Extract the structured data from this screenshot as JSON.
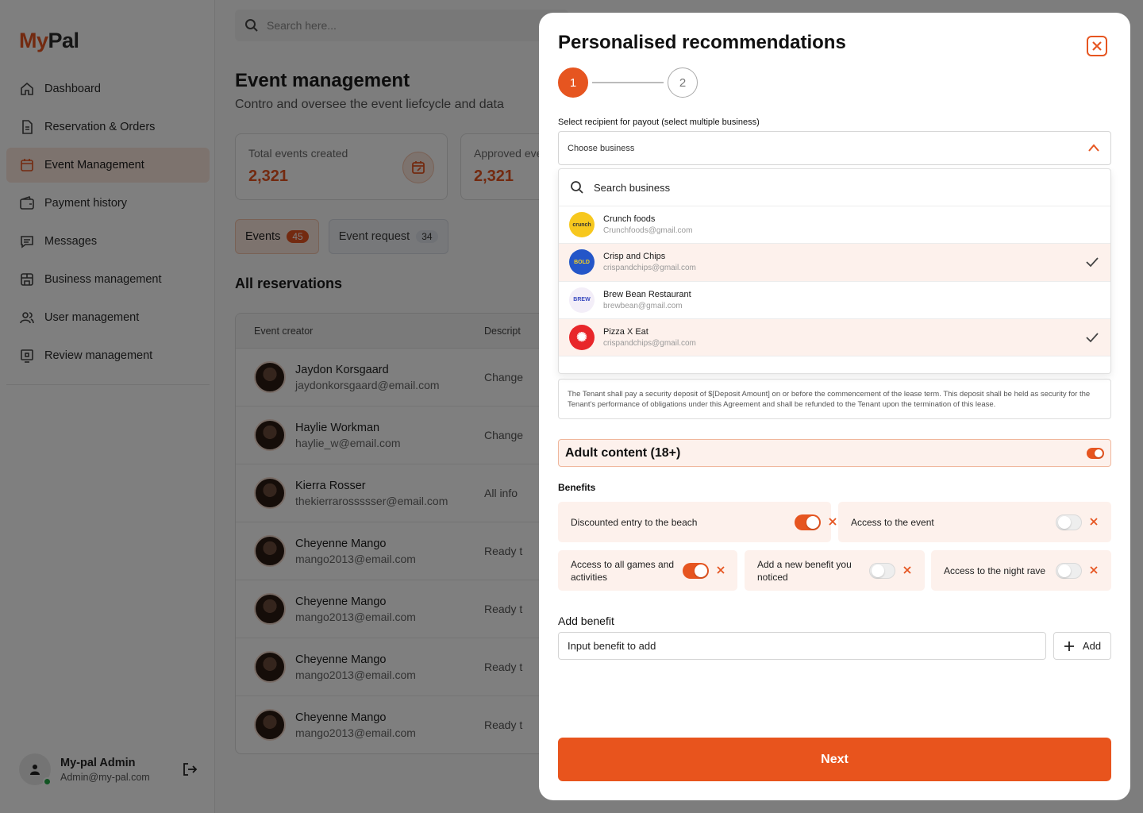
{
  "app": {
    "logo_a": "My",
    "logo_b": "Pal"
  },
  "sidebar": {
    "items": [
      {
        "label": "Dashboard",
        "icon": "home-icon"
      },
      {
        "label": "Reservation & Orders",
        "icon": "document-icon"
      },
      {
        "label": "Event Management",
        "icon": "calendar-icon",
        "active": true
      },
      {
        "label": "Payment history",
        "icon": "wallet-icon"
      },
      {
        "label": "Messages",
        "icon": "message-icon"
      },
      {
        "label": "Business management",
        "icon": "store-icon"
      },
      {
        "label": "User management",
        "icon": "users-icon"
      },
      {
        "label": "Review management",
        "icon": "review-icon"
      }
    ],
    "profile": {
      "name": "My-pal Admin",
      "email": "Admin@my-pal.com"
    }
  },
  "main": {
    "search_placeholder": "Search here...",
    "title": "Event management",
    "subtitle": "Contro and oversee the event liefcycle and data",
    "stats": [
      {
        "label": "Total events created",
        "value": "2,321"
      },
      {
        "label": "Approved eve",
        "value": "2,321"
      }
    ],
    "tabs": [
      {
        "label": "Events",
        "count": "45"
      },
      {
        "label": "Event request",
        "count": "34"
      }
    ],
    "section_title": "All reservations",
    "table": {
      "columns": [
        "Event creator",
        "Descript"
      ],
      "rows": [
        {
          "name": "Jaydon Korsgaard",
          "email": "jaydonkorsgaard@email.com",
          "desc": "Change"
        },
        {
          "name": "Haylie Workman",
          "email": "haylie_w@email.com",
          "desc": "Change"
        },
        {
          "name": "Kierra Rosser",
          "email": "thekierrarossssser@email.com",
          "desc": "All info"
        },
        {
          "name": "Cheyenne Mango",
          "email": "mango2013@email.com",
          "desc": "Ready t"
        },
        {
          "name": "Cheyenne Mango",
          "email": "mango2013@email.com",
          "desc": "Ready t"
        },
        {
          "name": "Cheyenne Mango",
          "email": "mango2013@email.com",
          "desc": "Ready t"
        },
        {
          "name": "Cheyenne Mango",
          "email": "mango2013@email.com",
          "desc": "Ready t"
        }
      ]
    }
  },
  "modal": {
    "title": "Personalised recommendations",
    "steps": [
      "1",
      "2"
    ],
    "current_step": 1,
    "recipient_label": "Select recipient for payout (select multiple business)",
    "select_placeholder": "Choose business",
    "dropdown": {
      "search_placeholder": "Search business",
      "items": [
        {
          "name": "Crunch foods",
          "email": "Crunchfoods@gmail.com",
          "selected": false,
          "logo_text": "crunch",
          "logo_color": "#f7c81e"
        },
        {
          "name": "Crisp and Chips",
          "email": "crispandchips@gmail.com",
          "selected": true,
          "logo_text": "BOLD",
          "logo_color": "#2456c8"
        },
        {
          "name": "Brew Bean Restaurant",
          "email": "brewbean@gmail.com",
          "selected": false,
          "logo_text": "BREW",
          "logo_color": "#f3eef8"
        },
        {
          "name": "Pizza X Eat",
          "email": "crispandchips@gmail.com",
          "selected": true,
          "logo_text": "✺",
          "logo_color": "#e8262a"
        }
      ]
    },
    "terms_text": "The Tenant shall pay a security deposit of $[Deposit Amount] on or before the commencement of the lease term. This deposit shall be held as security for the Tenant's performance of obligations under this Agreement and shall be refunded to the Tenant upon the termination of this lease.",
    "adult_label": "Adult content (18+)",
    "adult_on": true,
    "benefits_label": "Benefits",
    "benefits": [
      {
        "label": "Discounted entry to the beach",
        "on": true
      },
      {
        "label": "Access to the event",
        "on": false
      },
      {
        "label": "Access to all games and activities",
        "on": true
      },
      {
        "label": "Add a new benefit you noticed",
        "on": false
      },
      {
        "label": "Access to the night rave",
        "on": false
      }
    ],
    "add_benefit_label": "Add benefit",
    "add_benefit_placeholder": "Input benefit to add",
    "add_button": "Add",
    "next_button": "Next"
  },
  "colors": {
    "accent": "#e65520",
    "accent_soft": "#fdf1ec"
  }
}
